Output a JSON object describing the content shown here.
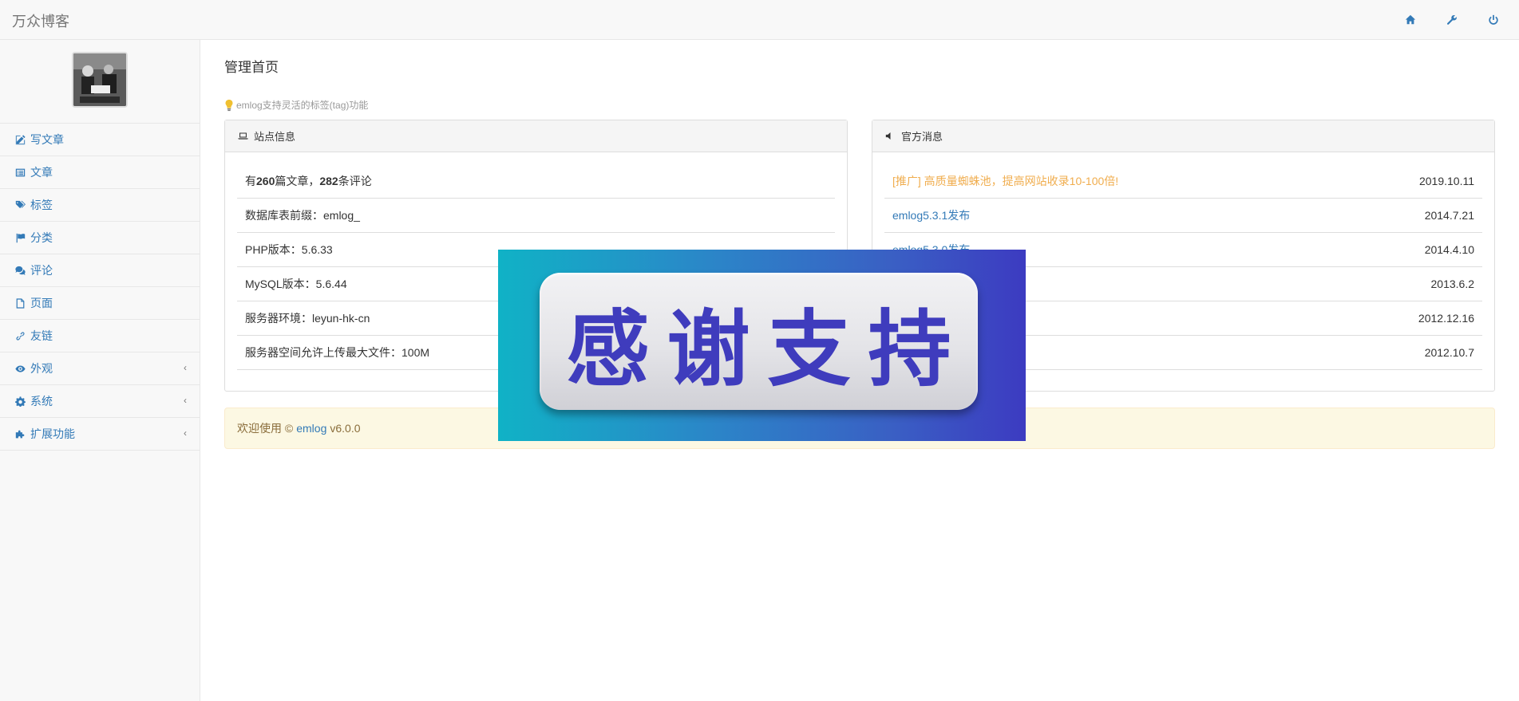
{
  "app": {
    "brand": "万众博客"
  },
  "topbar": {
    "icons": [
      "home-icon",
      "wrench-icon",
      "power-icon"
    ]
  },
  "sidebar": {
    "items": [
      {
        "label": "写文章",
        "icon": "edit-icon",
        "has_submenu": false
      },
      {
        "label": "文章",
        "icon": "list-icon",
        "has_submenu": false
      },
      {
        "label": "标签",
        "icon": "tags-icon",
        "has_submenu": false
      },
      {
        "label": "分类",
        "icon": "flag-icon",
        "has_submenu": false
      },
      {
        "label": "评论",
        "icon": "comments-icon",
        "has_submenu": false
      },
      {
        "label": "页面",
        "icon": "file-icon",
        "has_submenu": false
      },
      {
        "label": "友链",
        "icon": "link-icon",
        "has_submenu": false
      },
      {
        "label": "外观",
        "icon": "eye-icon",
        "has_submenu": true
      },
      {
        "label": "系统",
        "icon": "gear-icon",
        "has_submenu": true
      },
      {
        "label": "扩展功能",
        "icon": "puzzle-icon",
        "has_submenu": true
      }
    ],
    "submenu_arrow": "‹"
  },
  "main": {
    "title": "管理首页",
    "tip": "emlog支持灵活的标签(tag)功能",
    "site_panel": {
      "heading": "站点信息",
      "stats": {
        "prefix": "有",
        "articles": "260",
        "articles_unit": "篇文章，",
        "comments": "282",
        "comments_unit": "条评论"
      },
      "rows": [
        "数据库表前缀：emlog_",
        "PHP版本：5.6.33",
        "MySQL版本：5.6.44",
        "服务器环境：leyun-hk-cn",
        "服务器空间允许上传最大文件：100M"
      ]
    },
    "news_panel": {
      "heading": "官方消息",
      "items": [
        {
          "title": "[推广] 高质量蜘蛛池，提高网站收录10-100倍!",
          "date": "2019.10.11",
          "promo": true
        },
        {
          "title": "emlog5.3.1发布",
          "date": "2014.7.21",
          "promo": false
        },
        {
          "title": "emlog5.3.0发布",
          "date": "2014.4.10",
          "promo": false
        },
        {
          "title": "",
          "date": "2013.6.2",
          "promo": false
        },
        {
          "title": "",
          "date": "2012.12.16",
          "promo": false
        },
        {
          "title": "",
          "date": "2012.10.7",
          "promo": false
        }
      ]
    },
    "welcome": {
      "prefix": "欢迎使用 ©",
      "link": "emlog",
      "version": "v6.0.0"
    }
  },
  "overlay_ad": {
    "text": "感谢支持"
  },
  "colors": {
    "link": "#337ab7",
    "promo": "#f0ad4e",
    "welcome_bg": "#fcf8e3",
    "ad_text": "#3f3cbd"
  }
}
